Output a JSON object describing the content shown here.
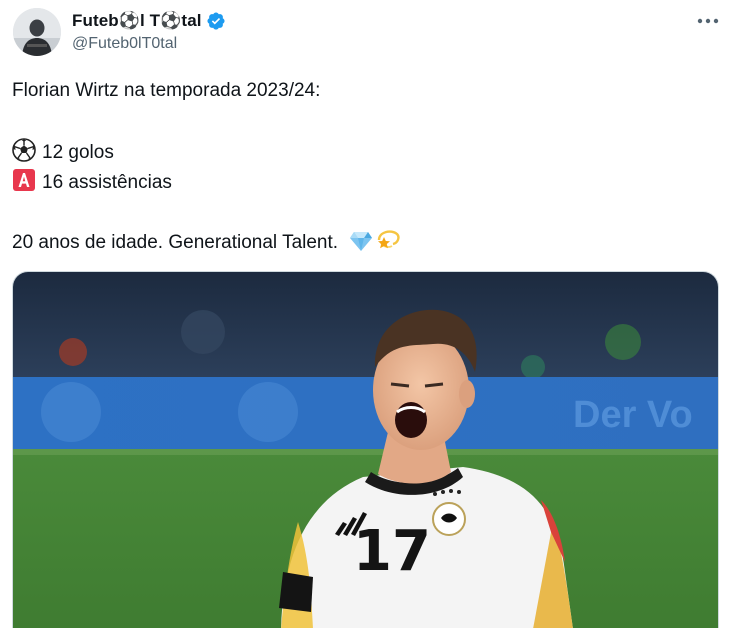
{
  "author": {
    "display_name": "Futeb⚽l T⚽tal",
    "handle": "@Futeb0lT0tal",
    "verified": true,
    "avatar_icon": "person-avatar-icon"
  },
  "menu": {
    "icon": "more-options-icon"
  },
  "tweet": {
    "line1": "Florian Wirtz na temporada 2023/24:",
    "goals_text": "12 golos",
    "goals_icon": "soccer-ball-icon",
    "assists_text": "16 assistências",
    "assists_icon": "letter-a-icon",
    "line4": "20 anos de idade. Generational Talent.",
    "trailing_icons": [
      "gem-icon",
      "dizzy-star-icon"
    ]
  },
  "media": {
    "description_icon": "player-photo",
    "jersey_number": "17"
  },
  "colors": {
    "verified_blue": "#1d9bf0",
    "handle_gray": "#536471",
    "assist_red": "#e8374d"
  }
}
